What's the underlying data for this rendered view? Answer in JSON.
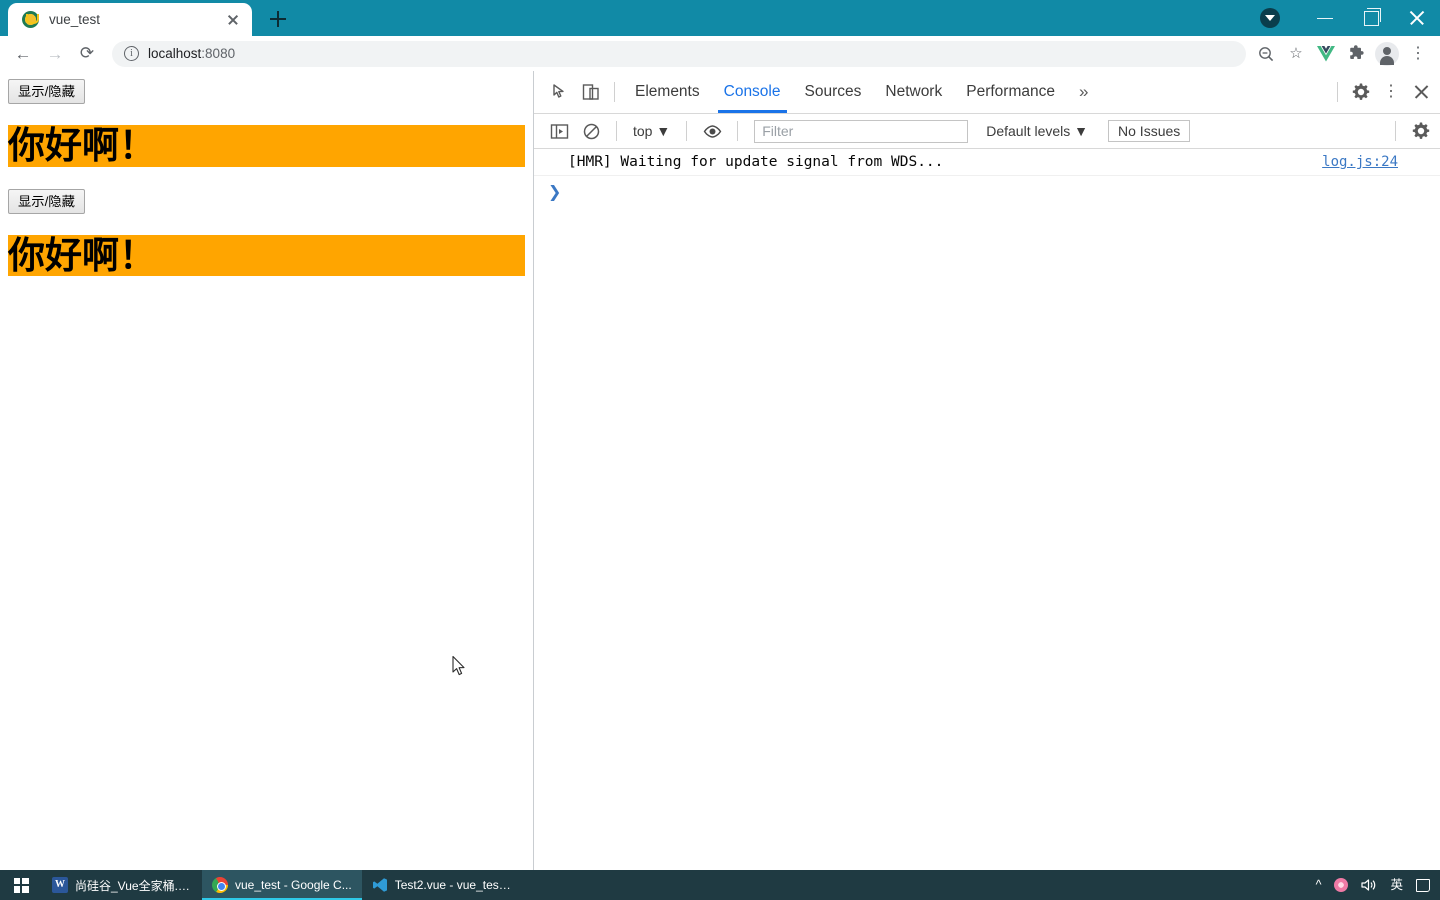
{
  "browser": {
    "tab": {
      "title": "vue_test",
      "favicon_icon": "vue-u-favicon",
      "close_icon": "close-icon"
    },
    "new_tab_icon": "plus-icon",
    "window_controls": {
      "download_indicator_icon": "download-indicator-icon",
      "minimize_icon": "minimize-icon",
      "maximize_icon": "maximize-icon",
      "close_icon": "close-icon"
    },
    "toolbar": {
      "back_icon": "←",
      "forward_icon": "→",
      "reload_icon": "⟳",
      "site_info_icon": "i",
      "url_host": "localhost",
      "url_port": ":8080",
      "zoom_icon": "zoom-icon",
      "bookmark_icon": "☆",
      "vue_devtools_icon": "vue-logo-icon",
      "extensions_icon": "puzzle-icon",
      "profile_icon": "avatar-icon",
      "menu_icon": "⋮"
    }
  },
  "page": {
    "button1_label": "显示/隐藏",
    "banner1_text": "你好啊！",
    "button2_label": "显示/隐藏",
    "banner2_text": "你好啊！",
    "banner_color": "#ffa500",
    "cursor_icon": "mouse-pointer-icon"
  },
  "devtools": {
    "inspect_icon": "inspect-element-icon",
    "device_toolbar_icon": "device-toolbar-icon",
    "tabs": [
      {
        "label": "Elements",
        "active": false
      },
      {
        "label": "Console",
        "active": true
      },
      {
        "label": "Sources",
        "active": false
      },
      {
        "label": "Network",
        "active": false
      },
      {
        "label": "Performance",
        "active": false
      }
    ],
    "overflow_label": "»",
    "settings_icon": "gear-icon",
    "more_icon": "⋮",
    "close_icon": "close-icon",
    "filterbar": {
      "sidebar_toggle_icon": "console-sidebar-icon",
      "clear_console_icon": "clear-console-icon",
      "context_value": "top",
      "context_caret": "▼",
      "live_expression_icon": "eye-icon",
      "filter_placeholder": "Filter",
      "filter_value": "",
      "levels_value": "Default levels",
      "levels_caret": "▼",
      "issues_label": "No Issues",
      "settings_icon": "gear-icon"
    },
    "console": {
      "messages": [
        {
          "text": "[HMR] Waiting for update signal from WDS...",
          "source": "log.js:24"
        }
      ],
      "prompt_caret": "❯"
    }
  },
  "taskbar": {
    "start_icon": "windows-logo-icon",
    "items": [
      {
        "label": "尚硅谷_Vue全家桶.d...",
        "icon": "word-icon",
        "active": false
      },
      {
        "label": "vue_test - Google C...",
        "icon": "chrome-icon",
        "active": true
      },
      {
        "label": "Test2.vue - vue_test...",
        "icon": "vscode-icon",
        "active": false
      }
    ],
    "tray": {
      "chevron_up": "^",
      "ime_flower_icon": "sogou-ime-icon",
      "volume_icon": "🔊",
      "language_label": "英",
      "notifications_icon": "action-center-icon"
    }
  }
}
